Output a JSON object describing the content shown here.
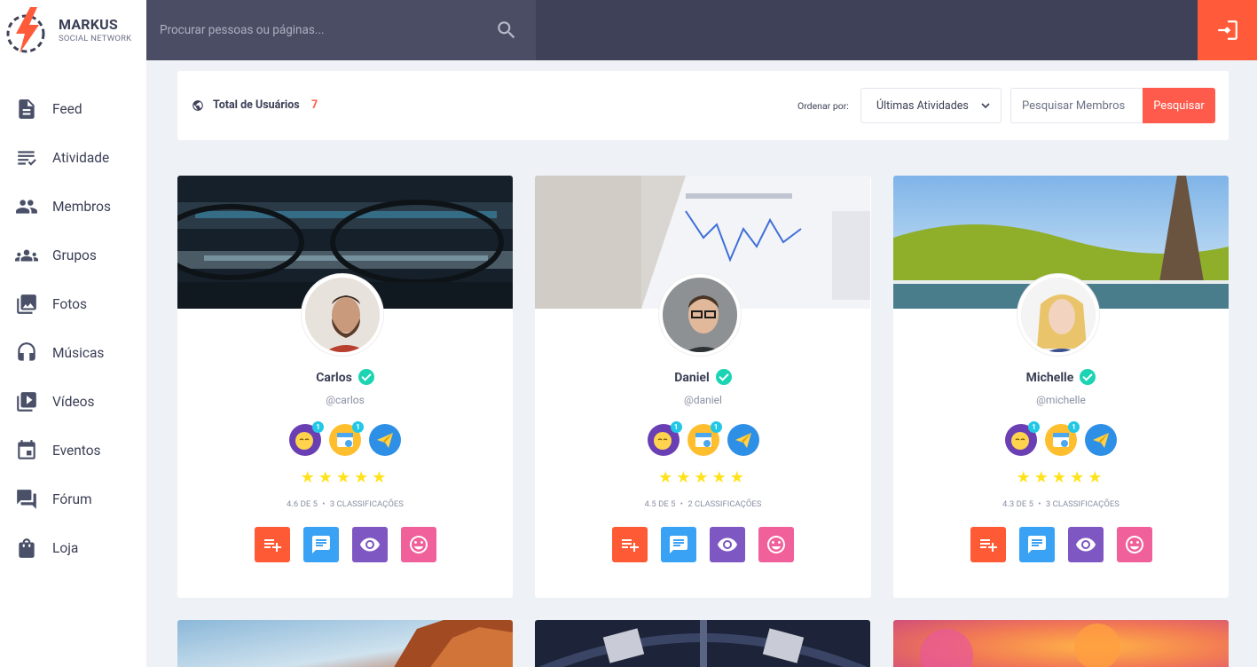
{
  "brand": {
    "title": "MARKUS",
    "subtitle": "SOCIAL NETWORK",
    "accent": "#ff5b3a"
  },
  "search": {
    "placeholder": "Procurar pessoas ou páginas..."
  },
  "sidebar": {
    "items": [
      {
        "label": "Feed",
        "icon": "feed-icon"
      },
      {
        "label": "Atividade",
        "icon": "activity-icon"
      },
      {
        "label": "Membros",
        "icon": "members-icon"
      },
      {
        "label": "Grupos",
        "icon": "groups-icon"
      },
      {
        "label": "Fotos",
        "icon": "photos-icon"
      },
      {
        "label": "Músicas",
        "icon": "headphones-icon"
      },
      {
        "label": "Vídeos",
        "icon": "video-icon"
      },
      {
        "label": "Eventos",
        "icon": "calendar-icon"
      },
      {
        "label": "Fórum",
        "icon": "forum-icon"
      },
      {
        "label": "Loja",
        "icon": "shop-icon"
      }
    ]
  },
  "filter": {
    "total_label": "Total de Usuários",
    "total_count": "7",
    "sort_label": "Ordenar por:",
    "sort_value": "Últimas Atividades",
    "member_placeholder": "Pesquisar Membros",
    "search_button": "Pesquisar"
  },
  "members": [
    {
      "name": "Carlos",
      "handle": "@carlos",
      "rating": "4.6 DE 5",
      "count": "3 CLASSIFICAÇÕES",
      "stars": 5
    },
    {
      "name": "Daniel",
      "handle": "@daniel",
      "rating": "4.5 DE 5",
      "count": "2 CLASSIFICAÇÕES",
      "stars": 5
    },
    {
      "name": "Michelle",
      "handle": "@michelle",
      "rating": "4.3 DE 5",
      "count": "3 CLASSIFICAÇÕES",
      "stars": 5
    }
  ],
  "badge_counts": [
    "1",
    "1"
  ],
  "action_colors": [
    "#ff5a36",
    "#3aa2f4",
    "#7e57c2",
    "#f0609a"
  ],
  "separator": "•"
}
